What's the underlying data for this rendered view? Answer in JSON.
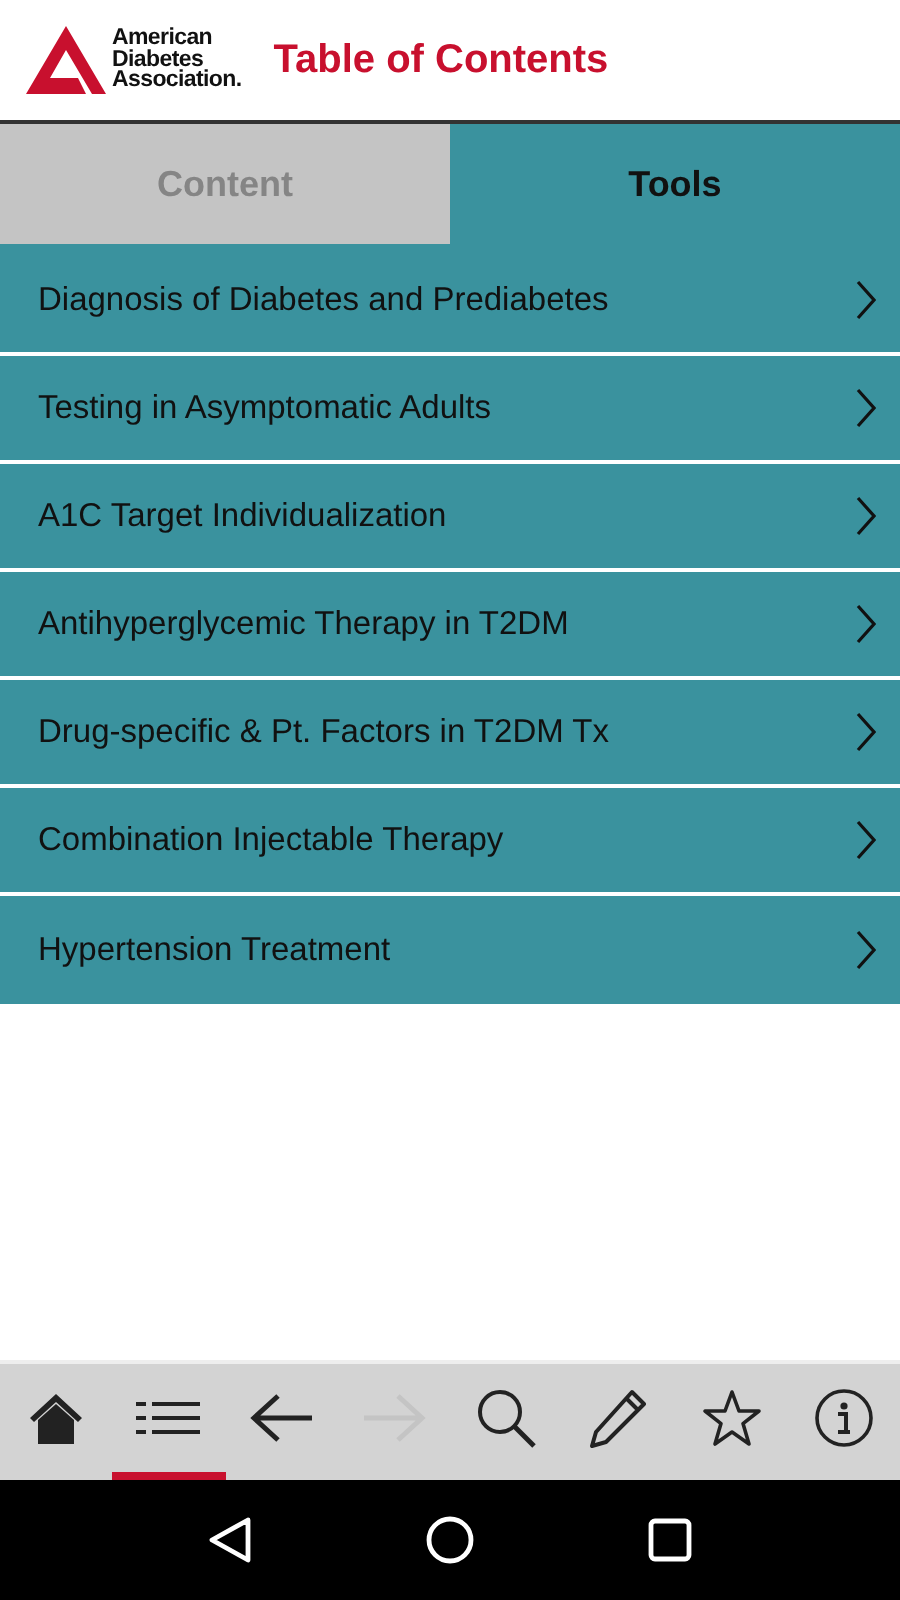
{
  "header": {
    "logo_lines": [
      "American",
      "Diabetes",
      "Association."
    ],
    "title": "Table of Contents"
  },
  "tabs": [
    {
      "label": "Content",
      "selected": false
    },
    {
      "label": "Tools",
      "selected": true
    }
  ],
  "items": [
    {
      "label": "Diagnosis of Diabetes and Prediabetes"
    },
    {
      "label": "Testing in Asymptomatic Adults"
    },
    {
      "label": "A1C Target Individualization"
    },
    {
      "label": "Antihyperglycemic Therapy in T2DM"
    },
    {
      "label": "Drug-specific & Pt. Factors in T2DM Tx"
    },
    {
      "label": "Combination Injectable Therapy"
    },
    {
      "label": "Hypertension Treatment"
    }
  ],
  "toolbar": [
    {
      "kind": "home",
      "selected": false,
      "disabled": false
    },
    {
      "kind": "list",
      "selected": true,
      "disabled": false
    },
    {
      "kind": "back",
      "selected": false,
      "disabled": false
    },
    {
      "kind": "forward",
      "selected": false,
      "disabled": true
    },
    {
      "kind": "search",
      "selected": false,
      "disabled": false
    },
    {
      "kind": "edit",
      "selected": false,
      "disabled": false
    },
    {
      "kind": "star",
      "selected": false,
      "disabled": false
    },
    {
      "kind": "info",
      "selected": false,
      "disabled": false
    }
  ],
  "nav": [
    {
      "kind": "back"
    },
    {
      "kind": "home"
    },
    {
      "kind": "recents"
    }
  ]
}
